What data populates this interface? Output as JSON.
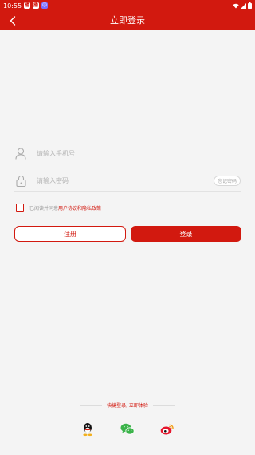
{
  "status_bar": {
    "time": "10:55",
    "badge1": "播",
    "badge2": "播"
  },
  "header": {
    "title": "立即登录"
  },
  "form": {
    "phone_placeholder": "请输入手机号",
    "password_placeholder": "请输入密码",
    "forgot_label": "忘记密码"
  },
  "agreement": {
    "prefix": "已阅读并同意",
    "link": "用户协议和隐私政策"
  },
  "buttons": {
    "register": "注册",
    "login": "登录"
  },
  "quick_login": {
    "label": "快捷登录, 立即体验"
  },
  "colors": {
    "brand": "#d2190f"
  }
}
